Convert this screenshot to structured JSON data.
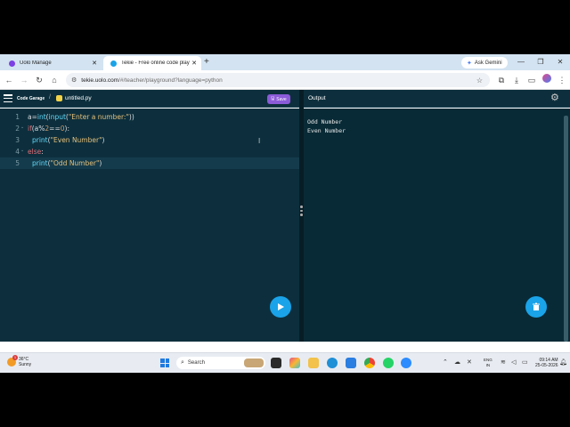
{
  "browser": {
    "tabs": [
      {
        "title": "Uolo Manage",
        "active": false,
        "favicon_color": "#7b3fe4"
      },
      {
        "title": "Tekie - Free online code playgr",
        "active": true,
        "favicon_color": "#1aa3e8"
      }
    ],
    "new_tab": "+",
    "gemini_label": "Ask Gemini",
    "address": {
      "host": "tekie.uolo.com",
      "path": "/#/teacher/playground?language=python"
    }
  },
  "app": {
    "brand": "Code Garage",
    "separator": "/",
    "file_name": "untitled.py",
    "save_label": "Save",
    "output_label": "Output"
  },
  "editor": {
    "lines": [
      {
        "num": "1",
        "fold": "",
        "indent": false,
        "tokens": [
          {
            "t": "a=",
            "c": "pl"
          },
          {
            "t": "int",
            "c": "fn"
          },
          {
            "t": "(",
            "c": "pl"
          },
          {
            "t": "input",
            "c": "fn"
          },
          {
            "t": "(",
            "c": "pl"
          },
          {
            "t": "\"Enter a number:\"",
            "c": "st"
          },
          {
            "t": "))",
            "c": "pl"
          }
        ]
      },
      {
        "num": "2",
        "fold": "⌄",
        "indent": false,
        "tokens": [
          {
            "t": "if",
            "c": "kw"
          },
          {
            "t": "(a%",
            "c": "pl"
          },
          {
            "t": "2",
            "c": "nm"
          },
          {
            "t": "==",
            "c": "pl"
          },
          {
            "t": "0",
            "c": "nm"
          },
          {
            "t": "):",
            "c": "pl"
          }
        ]
      },
      {
        "num": "3",
        "fold": "",
        "indent": true,
        "tokens": [
          {
            "t": "print",
            "c": "fn"
          },
          {
            "t": "(",
            "c": "pl"
          },
          {
            "t": "\"Even Number\"",
            "c": "st"
          },
          {
            "t": ")",
            "c": "pl"
          }
        ]
      },
      {
        "num": "4",
        "fold": "⌄",
        "indent": false,
        "tokens": [
          {
            "t": "else",
            "c": "kw"
          },
          {
            "t": ":",
            "c": "pl"
          }
        ]
      },
      {
        "num": "5",
        "fold": "",
        "indent": true,
        "highlight": true,
        "tokens": [
          {
            "t": "print",
            "c": "fn"
          },
          {
            "t": "(",
            "c": "pl"
          },
          {
            "t": "\"Odd Number\"",
            "c": "st"
          },
          {
            "t": ")",
            "c": "pl"
          }
        ]
      }
    ]
  },
  "output": {
    "lines": [
      "Odd Number",
      "Even Number"
    ]
  },
  "taskbar": {
    "weather_temp": "36°C",
    "weather_desc": "Sunny",
    "notification_count": "1",
    "search_placeholder": "Search",
    "lang_line1": "ENG",
    "lang_line2": "IN",
    "time": "09:14 AM",
    "date": "25-05-2026"
  },
  "colors": {
    "editor_bg": "#0d2f3d",
    "accent": "#1aa3e8",
    "save_button": "#8b5bd8"
  }
}
